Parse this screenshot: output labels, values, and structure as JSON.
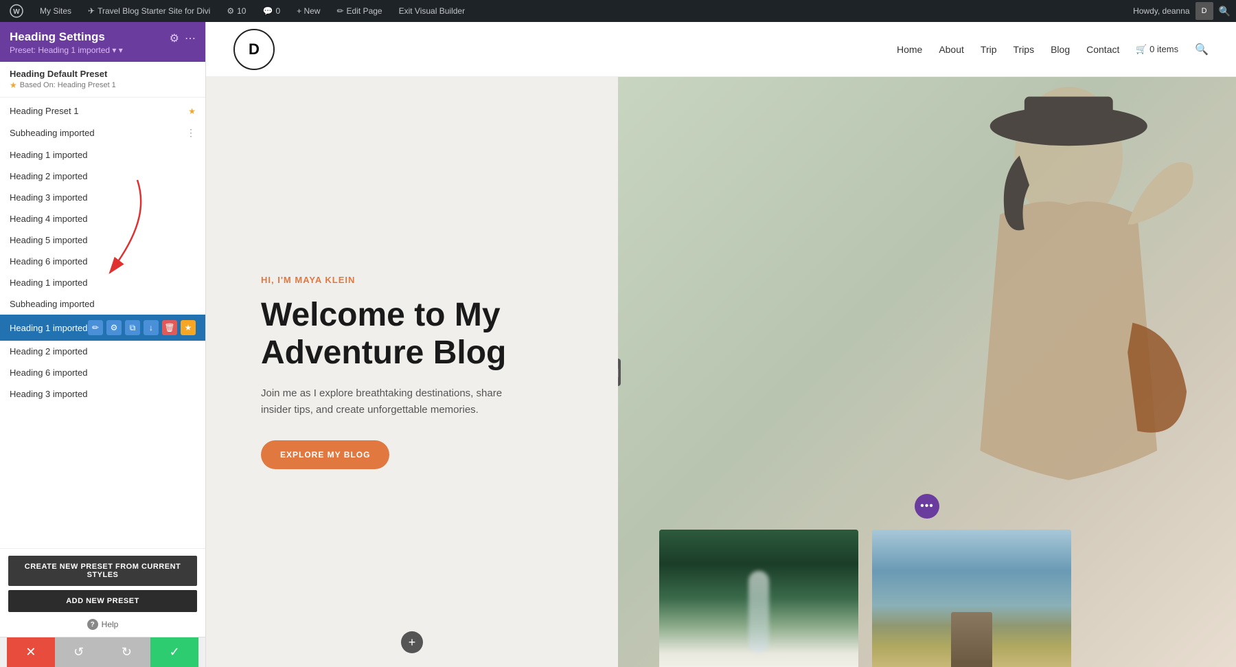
{
  "admin_bar": {
    "wp_icon": "⊞",
    "items": [
      {
        "label": "My Sites",
        "icon": "🏠"
      },
      {
        "label": "Travel Blog Starter Site for Divi",
        "icon": "✈"
      },
      {
        "label": "10",
        "icon": "⚙"
      },
      {
        "label": "0",
        "icon": "💬"
      },
      {
        "label": "+ New",
        "icon": "+"
      },
      {
        "label": "Edit Page"
      },
      {
        "label": "Exit Visual Builder"
      }
    ],
    "right": "Howdy, deanna"
  },
  "sidebar": {
    "title": "Heading Settings",
    "preset_label": "Preset: Heading 1 imported ▾",
    "icons": [
      "⚙",
      "⋯"
    ],
    "default_preset": {
      "name": "Heading Default Preset",
      "based_on": "Based On: Heading Preset 1"
    },
    "presets": [
      {
        "name": "Heading Preset 1",
        "has_star": true
      },
      {
        "name": "Subheading imported",
        "has_star": false
      },
      {
        "name": "Heading 1 imported",
        "has_star": false
      },
      {
        "name": "Heading 2 imported",
        "has_star": false
      },
      {
        "name": "Heading 3 imported",
        "has_star": false
      },
      {
        "name": "Heading 4 imported",
        "has_star": false
      },
      {
        "name": "Heading 5 imported",
        "has_star": false
      },
      {
        "name": "Heading 6 imported",
        "has_star": false
      },
      {
        "name": "Heading 1 imported",
        "has_star": false
      },
      {
        "name": "Subheading imported",
        "has_star": false
      }
    ],
    "active_preset": "Heading 1 imported",
    "after_active": [
      {
        "name": "Heading 2 imported"
      },
      {
        "name": "Heading 6 imported"
      },
      {
        "name": "Heading 3 imported"
      }
    ],
    "btn_create": "CREATE NEW PRESET FROM CURRENT STYLES",
    "btn_add": "ADD NEW PRESET",
    "help": "Help"
  },
  "bottom_bar": {
    "cancel_icon": "✕",
    "undo_icon": "↺",
    "redo_icon": "↻",
    "confirm_icon": "✓"
  },
  "site": {
    "logo": "D",
    "nav_links": [
      "Home",
      "About",
      "Trip",
      "Trips",
      "Blog",
      "Contact",
      "🛒 0 items",
      "🔍"
    ],
    "hero": {
      "tagline": "HI, I'M MAYA KLEIN",
      "title": "Welcome to My Adventure Blog",
      "description": "Join me as I explore breathtaking destinations, share insider tips, and create unforgettable memories.",
      "btn_label": "EXPLORE MY BLOG"
    }
  }
}
